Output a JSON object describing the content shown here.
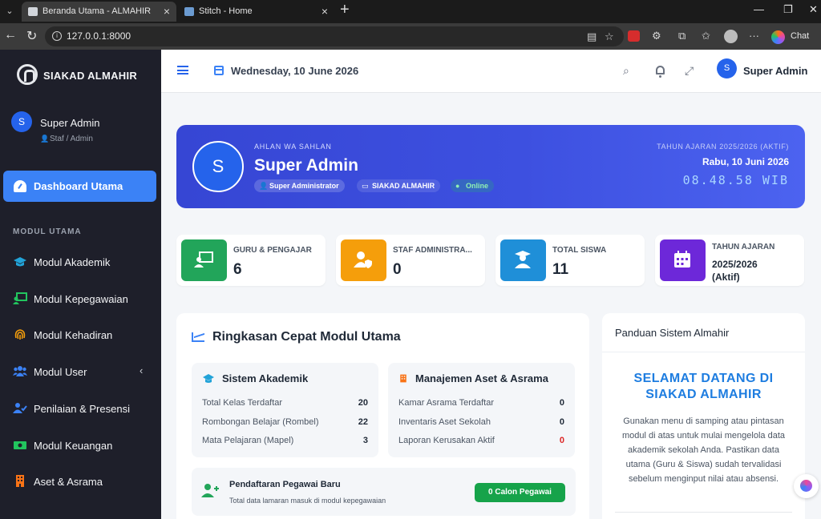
{
  "browser": {
    "tabs": [
      {
        "title": "Beranda Utama - ALMAHIR",
        "active": true
      },
      {
        "title": "Stitch - Home",
        "active": false
      }
    ],
    "url": "127.0.0.1:8000",
    "chat_label": "Chat"
  },
  "sidebar": {
    "brand": "SIAKAD ALMAHIR",
    "user_initial": "S",
    "user_name": "Super Admin",
    "user_role": "Staf / Admin",
    "active_item": "Dashboard Utama",
    "section_label": "MODUL UTAMA",
    "items": [
      {
        "label": "Modul Akademik",
        "icon": "graduation-cap-icon"
      },
      {
        "label": "Modul Kepegawaian",
        "icon": "chalkboard-teacher-icon"
      },
      {
        "label": "Modul Kehadiran",
        "icon": "fingerprint-icon"
      },
      {
        "label": "Modul User",
        "icon": "users-icon"
      },
      {
        "label": "Penilaian & Presensi",
        "icon": "user-check-icon"
      },
      {
        "label": "Modul Keuangan",
        "icon": "money-bill-icon"
      },
      {
        "label": "Aset & Asrama",
        "icon": "building-icon"
      }
    ]
  },
  "header": {
    "date": "Wednesday, 10 June 2026",
    "user_initial": "S",
    "user_name": "Super Admin"
  },
  "hero": {
    "initial": "S",
    "greeting": "AHLAN WA SAHLAN",
    "name": "Super Admin",
    "chips": [
      "Super Administrator",
      "SIAKAD ALMAHIR",
      "Online"
    ],
    "academic_year": "TAHUN AJARAN 2025/2026 (AKTIF)",
    "local_date": "Rabu, 10 Juni 2026",
    "clock": "08.48.58 WIB"
  },
  "stats": [
    {
      "label": "GURU & PENGAJAR",
      "value": "6",
      "color": "#22a55a"
    },
    {
      "label": "STAF ADMINISTRA...",
      "value": "0",
      "color": "#f59e0b"
    },
    {
      "label": "TOTAL SISWA",
      "value": "11",
      "color": "#1f8fd8"
    },
    {
      "label": "TAHUN AJARAN",
      "value": "2025/2026 (Aktif)",
      "color": "#6d28d9"
    }
  ],
  "summary": {
    "title": "Ringkasan Cepat Modul Utama",
    "akademik": {
      "title": "Sistem Akademik",
      "rows": [
        {
          "label": "Total Kelas Terdaftar",
          "value": "20"
        },
        {
          "label": "Rombongan Belajar (Rombel)",
          "value": "22"
        },
        {
          "label": "Mata Pelajaran (Mapel)",
          "value": "3"
        }
      ]
    },
    "aset": {
      "title": "Manajemen Aset & Asrama",
      "rows": [
        {
          "label": "Kamar Asrama Terdaftar",
          "value": "0"
        },
        {
          "label": "Inventaris Aset Sekolah",
          "value": "0"
        },
        {
          "label": "Laporan Kerusakan Aktif",
          "value": "0"
        }
      ]
    },
    "registration": {
      "title": "Pendaftaran Pegawai Baru",
      "subtitle": "Total data lamaran masuk di modul kepegawaian",
      "button": "0 Calon Pegawai"
    }
  },
  "guide": {
    "title": "Panduan Sistem Almahir",
    "welcome": "SELAMAT DATANG DI SIAKAD ALMAHIR",
    "body": "Gunakan menu di samping atau pintasan modul di atas untuk mulai mengelola data akademik sekolah Anda. Pastikan data utama (Guru & Siswa) sudah tervalidasi sebelum menginput nilai atau absensi."
  }
}
